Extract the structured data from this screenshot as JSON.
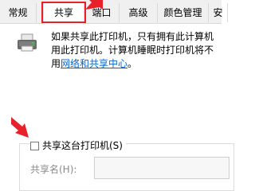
{
  "tabs": [
    {
      "label": "常规"
    },
    {
      "label": "共享"
    },
    {
      "label": "端口"
    },
    {
      "label": "高级"
    },
    {
      "label": "颜色管理"
    },
    {
      "label": "安"
    }
  ],
  "active_tab": "共享",
  "description": {
    "line1": "如果共享此打印机，只有拥有此计算机",
    "line2": "用此打印机。计算机睡眠时打印机将不",
    "line3_prefix": "用",
    "link": "网络和共享中心",
    "line3_suffix": "。"
  },
  "share_checkbox": {
    "label": "共享这台打印机(S)",
    "checked": false
  },
  "share_name": {
    "label": "共享名(H):",
    "value": ""
  },
  "colors": {
    "highlight": "#e8202a",
    "link": "#0a64c8"
  }
}
